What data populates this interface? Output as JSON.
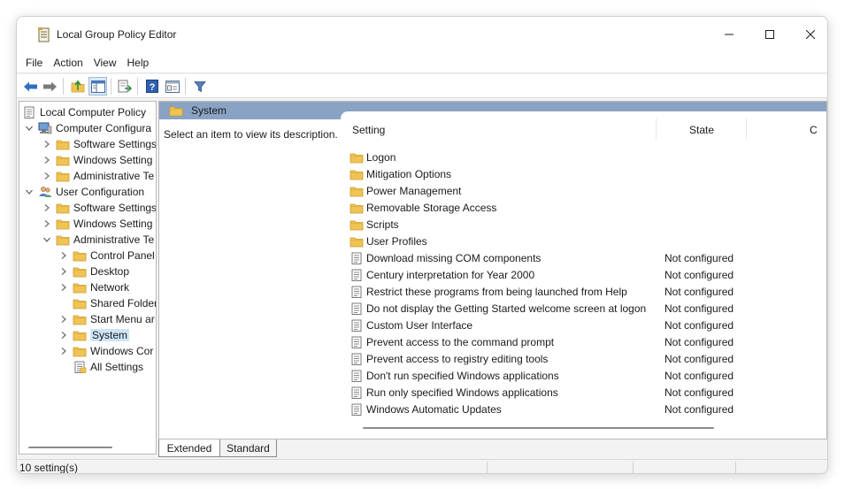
{
  "window": {
    "title": "Local Group Policy Editor"
  },
  "menu": [
    "File",
    "Action",
    "View",
    "Help"
  ],
  "toolbar": {
    "buttons": [
      "back-arrow-icon",
      "forward-arrow-icon",
      "up-folder-icon",
      "show-hide-tree-icon",
      "export-list-icon",
      "help-icon",
      "properties-icon",
      "filter-icon"
    ]
  },
  "tree": {
    "root": "Local Computer Policy",
    "computer_config": "Computer Configura",
    "cc_software": "Software Settings",
    "cc_windows": "Windows Setting",
    "cc_admin": "Administrative Te",
    "user_config": "User Configuration",
    "uc_software": "Software Settings",
    "uc_windows": "Windows Setting",
    "uc_admin": "Administrative Te",
    "control_panel": "Control Panel",
    "desktop": "Desktop",
    "network": "Network",
    "shared_folders": "Shared Folder",
    "start_menu": "Start Menu ar",
    "system": "System",
    "windows_components": "Windows Cor",
    "all_settings": "All Settings"
  },
  "right": {
    "header_title": "System",
    "description": "Select an item to view its description.",
    "columns": {
      "setting": "Setting",
      "state": "State",
      "comment": "C"
    },
    "folders": [
      "Logon",
      "Mitigation Options",
      "Power Management",
      "Removable Storage Access",
      "Scripts",
      "User Profiles"
    ],
    "settings": [
      {
        "name": "Download missing COM components",
        "state": "Not configured"
      },
      {
        "name": "Century interpretation for Year 2000",
        "state": "Not configured"
      },
      {
        "name": "Restrict these programs from being launched from Help",
        "state": "Not configured"
      },
      {
        "name": "Do not display the Getting Started welcome screen at logon",
        "state": "Not configured"
      },
      {
        "name": "Custom User Interface",
        "state": "Not configured"
      },
      {
        "name": "Prevent access to the command prompt",
        "state": "Not configured"
      },
      {
        "name": "Prevent access to registry editing tools",
        "state": "Not configured"
      },
      {
        "name": "Don't run specified Windows applications",
        "state": "Not configured"
      },
      {
        "name": "Run only specified Windows applications",
        "state": "Not configured"
      },
      {
        "name": "Windows Automatic Updates",
        "state": "Not configured"
      }
    ]
  },
  "tabs": {
    "extended": "Extended",
    "standard": "Standard"
  },
  "status": {
    "text": "10 setting(s)"
  },
  "colors": {
    "header_band": "#8aa3c4",
    "folder": "#f0c454",
    "selection": "#cce4f7",
    "accent_blue": "#2f6fc0"
  }
}
